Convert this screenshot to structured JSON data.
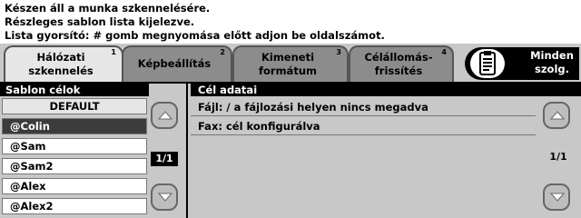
{
  "messages": [
    "Készen áll a munka szkennelésére.",
    "Részleges sablon lista kijelezve.",
    "Lista gyorsító: # gomb megnyomása előtt adjon be oldalszámot."
  ],
  "tabs": [
    {
      "label": "Hálózati\nszkennelés",
      "num": "1"
    },
    {
      "label": "Képbeállítás",
      "num": "2"
    },
    {
      "label": "Kimeneti\nformátum",
      "num": "3"
    },
    {
      "label": "Célállomás-\nfrissítés",
      "num": "4"
    }
  ],
  "all_services": "Minden\nszolg.",
  "templates": {
    "header": "Sablon célok",
    "items": [
      "DEFAULT",
      "@Colin",
      "@Sam",
      "@Sam2",
      "@Alex",
      "@Alex2"
    ],
    "selected": "@Colin",
    "page": "1/1"
  },
  "details": {
    "header": "Cél adatai",
    "file_line": "Fájl: / a fájlozási helyen nincs megadva",
    "fax_line": "Fax: cél konfigurálva",
    "page": "1/1"
  },
  "icons": {
    "all_services": "clipboard-icon",
    "scroll_up": "up-arrow-icon",
    "scroll_down": "down-arrow-icon"
  }
}
